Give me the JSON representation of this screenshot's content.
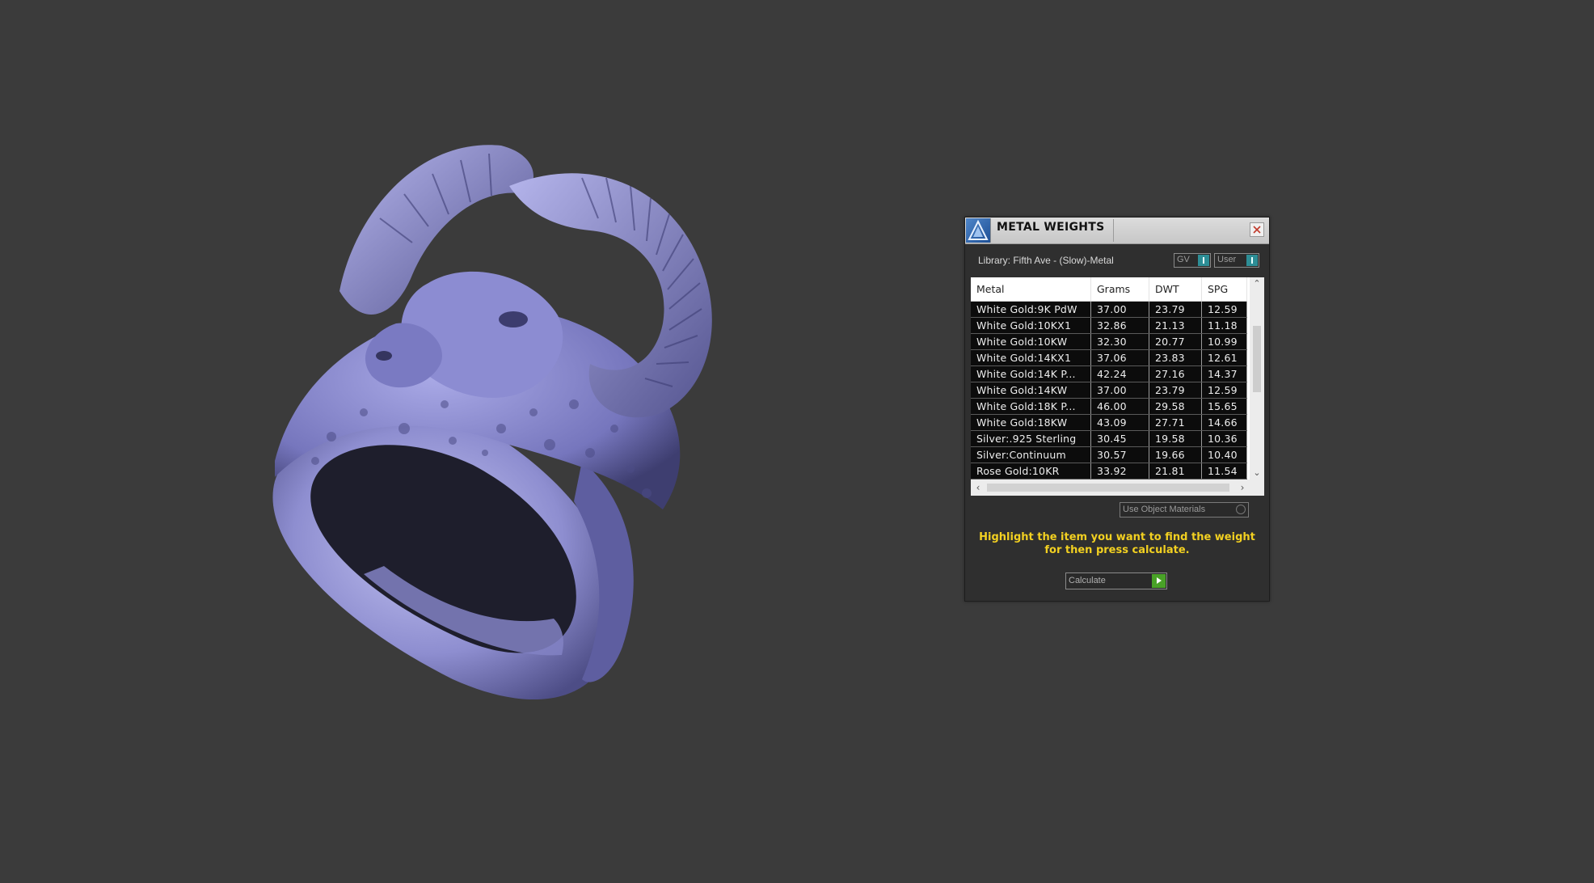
{
  "panel": {
    "title": "METAL WEIGHTS",
    "library_label": "Library: Fifth Ave - (Slow)-Metal",
    "toggle_gv": "GV",
    "toggle_user": "User",
    "columns": [
      "Metal",
      "Grams",
      "DWT",
      "SPG"
    ],
    "rows": [
      [
        "White Gold:9K PdW",
        "37.00",
        "23.79",
        "12.59"
      ],
      [
        "White Gold:10KX1",
        "32.86",
        "21.13",
        "11.18"
      ],
      [
        "White Gold:10KW",
        "32.30",
        "20.77",
        "10.99"
      ],
      [
        "White Gold:14KX1",
        "37.06",
        "23.83",
        "12.61"
      ],
      [
        "White Gold:14K P...",
        "42.24",
        "27.16",
        "14.37"
      ],
      [
        "White Gold:14KW",
        "37.00",
        "23.79",
        "12.59"
      ],
      [
        "White Gold:18K P...",
        "46.00",
        "29.58",
        "15.65"
      ],
      [
        "White Gold:18KW",
        "43.09",
        "27.71",
        "14.66"
      ],
      [
        "Silver:.925 Sterling",
        "30.45",
        "19.58",
        "10.36"
      ],
      [
        "Silver:Continuum",
        "30.57",
        "19.66",
        "10.40"
      ],
      [
        "Rose Gold:10KR",
        "33.92",
        "21.81",
        "11.54"
      ]
    ],
    "use_object_materials": "Use Object Materials",
    "instruction_line1": "Highlight the item you want to find the weight",
    "instruction_line2": "for then press calculate.",
    "calculate_label": "Calculate"
  },
  "colors": {
    "background": "#3b3b3b",
    "model": "#9a9ad8",
    "instruction": "#f2d021",
    "accent_teal": "#2d8e96",
    "go_green": "#49a227"
  },
  "icons": [
    "app-logo-icon",
    "close-icon",
    "scroll-up-icon",
    "scroll-down-icon",
    "scroll-left-icon",
    "scroll-right-icon",
    "play-icon"
  ]
}
